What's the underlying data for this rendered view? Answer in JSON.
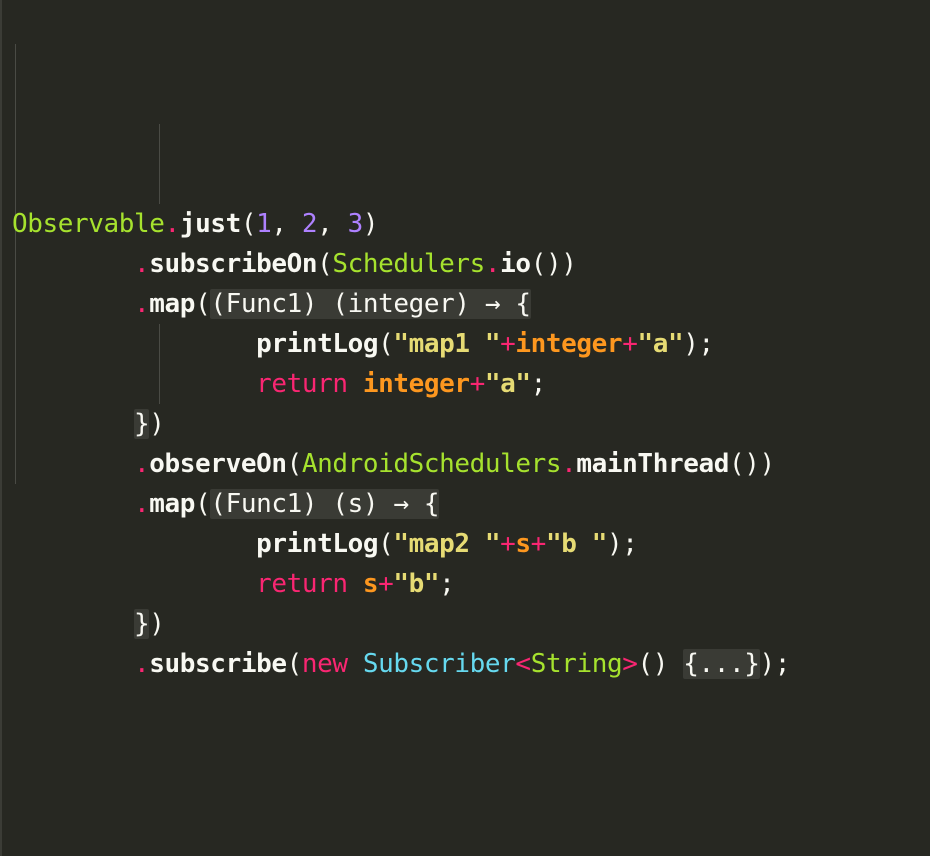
{
  "colors": {
    "background": "#272822",
    "default_text": "#f8f8f2",
    "class_green": "#a6e22e",
    "method_white": "#f8f8f2",
    "number_purple": "#ae81ff",
    "keyword_pink": "#f92672",
    "string_yellow": "#e6db74",
    "variable_orange": "#fd971f",
    "type_cyan": "#66d9ef",
    "fold_highlight": "#3a3b35"
  },
  "lines": [
    {
      "tokens": [
        {
          "text": "Observable",
          "color": "#a6e22e",
          "bold": false,
          "fold": false
        },
        {
          "text": ".",
          "color": "#f92672",
          "bold": false,
          "fold": false
        },
        {
          "text": "just",
          "color": "#f8f8f2",
          "bold": true,
          "fold": false
        },
        {
          "text": "(",
          "color": "#f8f8f2",
          "bold": false,
          "fold": false
        },
        {
          "text": "1",
          "color": "#ae81ff",
          "bold": false,
          "fold": false
        },
        {
          "text": ", ",
          "color": "#f8f8f2",
          "bold": false,
          "fold": false
        },
        {
          "text": "2",
          "color": "#ae81ff",
          "bold": false,
          "fold": false
        },
        {
          "text": ", ",
          "color": "#f8f8f2",
          "bold": false,
          "fold": false
        },
        {
          "text": "3",
          "color": "#ae81ff",
          "bold": false,
          "fold": false
        },
        {
          "text": ")",
          "color": "#f8f8f2",
          "bold": false,
          "fold": false
        }
      ]
    },
    {
      "tokens": [
        {
          "text": "        ",
          "color": "#f8f8f2",
          "bold": false,
          "fold": false
        },
        {
          "text": ".",
          "color": "#f92672",
          "bold": false,
          "fold": false
        },
        {
          "text": "subscribeOn",
          "color": "#f8f8f2",
          "bold": true,
          "fold": false
        },
        {
          "text": "(",
          "color": "#f8f8f2",
          "bold": false,
          "fold": false
        },
        {
          "text": "Schedulers",
          "color": "#a6e22e",
          "bold": false,
          "fold": false
        },
        {
          "text": ".",
          "color": "#f92672",
          "bold": false,
          "fold": false
        },
        {
          "text": "io",
          "color": "#f8f8f2",
          "bold": true,
          "fold": false
        },
        {
          "text": "())",
          "color": "#f8f8f2",
          "bold": false,
          "fold": false
        }
      ]
    },
    {
      "tokens": [
        {
          "text": "        ",
          "color": "#f8f8f2",
          "bold": false,
          "fold": false
        },
        {
          "text": ".",
          "color": "#f92672",
          "bold": false,
          "fold": false
        },
        {
          "text": "map",
          "color": "#f8f8f2",
          "bold": true,
          "fold": false
        },
        {
          "text": "(",
          "color": "#f8f8f2",
          "bold": false,
          "fold": false
        },
        {
          "text": "(Func1) (integer) → {",
          "color": "#f8f8f2",
          "bold": false,
          "fold": true
        }
      ]
    },
    {
      "tokens": [
        {
          "text": "                ",
          "color": "#f8f8f2",
          "bold": false,
          "fold": false
        },
        {
          "text": "printLog",
          "color": "#f8f8f2",
          "bold": true,
          "fold": false
        },
        {
          "text": "(",
          "color": "#f8f8f2",
          "bold": false,
          "fold": false
        },
        {
          "text": "\"map1 \"",
          "color": "#e6db74",
          "bold": true,
          "fold": false
        },
        {
          "text": "+",
          "color": "#f92672",
          "bold": false,
          "fold": false
        },
        {
          "text": "integer",
          "color": "#fd971f",
          "bold": true,
          "fold": false
        },
        {
          "text": "+",
          "color": "#f92672",
          "bold": false,
          "fold": false
        },
        {
          "text": "\"a\"",
          "color": "#e6db74",
          "bold": true,
          "fold": false
        },
        {
          "text": ");",
          "color": "#f8f8f2",
          "bold": false,
          "fold": false
        }
      ]
    },
    {
      "tokens": [
        {
          "text": "                ",
          "color": "#f8f8f2",
          "bold": false,
          "fold": false
        },
        {
          "text": "return",
          "color": "#f92672",
          "bold": false,
          "fold": false
        },
        {
          "text": " ",
          "color": "#f8f8f2",
          "bold": false,
          "fold": false
        },
        {
          "text": "integer",
          "color": "#fd971f",
          "bold": true,
          "fold": false
        },
        {
          "text": "+",
          "color": "#f92672",
          "bold": false,
          "fold": false
        },
        {
          "text": "\"a\"",
          "color": "#e6db74",
          "bold": true,
          "fold": false
        },
        {
          "text": ";",
          "color": "#f8f8f2",
          "bold": false,
          "fold": false
        }
      ]
    },
    {
      "tokens": [
        {
          "text": "        ",
          "color": "#f8f8f2",
          "bold": false,
          "fold": false
        },
        {
          "text": "}",
          "color": "#f8f8f2",
          "bold": false,
          "fold": true
        },
        {
          "text": ")",
          "color": "#f8f8f2",
          "bold": false,
          "fold": false
        }
      ]
    },
    {
      "tokens": [
        {
          "text": "        ",
          "color": "#f8f8f2",
          "bold": false,
          "fold": false
        },
        {
          "text": ".",
          "color": "#f92672",
          "bold": false,
          "fold": false
        },
        {
          "text": "observeOn",
          "color": "#f8f8f2",
          "bold": true,
          "fold": false
        },
        {
          "text": "(",
          "color": "#f8f8f2",
          "bold": false,
          "fold": false
        },
        {
          "text": "AndroidSchedulers",
          "color": "#a6e22e",
          "bold": false,
          "fold": false
        },
        {
          "text": ".",
          "color": "#f92672",
          "bold": false,
          "fold": false
        },
        {
          "text": "mainThread",
          "color": "#f8f8f2",
          "bold": true,
          "fold": false
        },
        {
          "text": "())",
          "color": "#f8f8f2",
          "bold": false,
          "fold": false
        }
      ]
    },
    {
      "tokens": [
        {
          "text": "        ",
          "color": "#f8f8f2",
          "bold": false,
          "fold": false
        },
        {
          "text": ".",
          "color": "#f92672",
          "bold": false,
          "fold": false
        },
        {
          "text": "map",
          "color": "#f8f8f2",
          "bold": true,
          "fold": false
        },
        {
          "text": "(",
          "color": "#f8f8f2",
          "bold": false,
          "fold": false
        },
        {
          "text": "(Func1) (s) → {",
          "color": "#f8f8f2",
          "bold": false,
          "fold": true
        }
      ]
    },
    {
      "tokens": [
        {
          "text": "                ",
          "color": "#f8f8f2",
          "bold": false,
          "fold": false
        },
        {
          "text": "printLog",
          "color": "#f8f8f2",
          "bold": true,
          "fold": false
        },
        {
          "text": "(",
          "color": "#f8f8f2",
          "bold": false,
          "fold": false
        },
        {
          "text": "\"map2 \"",
          "color": "#e6db74",
          "bold": true,
          "fold": false
        },
        {
          "text": "+",
          "color": "#f92672",
          "bold": false,
          "fold": false
        },
        {
          "text": "s",
          "color": "#fd971f",
          "bold": true,
          "fold": false
        },
        {
          "text": "+",
          "color": "#f92672",
          "bold": false,
          "fold": false
        },
        {
          "text": "\"b \"",
          "color": "#e6db74",
          "bold": true,
          "fold": false
        },
        {
          "text": ");",
          "color": "#f8f8f2",
          "bold": false,
          "fold": false
        }
      ]
    },
    {
      "tokens": [
        {
          "text": "                ",
          "color": "#f8f8f2",
          "bold": false,
          "fold": false
        },
        {
          "text": "return",
          "color": "#f92672",
          "bold": false,
          "fold": false
        },
        {
          "text": " ",
          "color": "#f8f8f2",
          "bold": false,
          "fold": false
        },
        {
          "text": "s",
          "color": "#fd971f",
          "bold": true,
          "fold": false
        },
        {
          "text": "+",
          "color": "#f92672",
          "bold": false,
          "fold": false
        },
        {
          "text": "\"b\"",
          "color": "#e6db74",
          "bold": true,
          "fold": false
        },
        {
          "text": ";",
          "color": "#f8f8f2",
          "bold": false,
          "fold": false
        }
      ]
    },
    {
      "tokens": [
        {
          "text": "        ",
          "color": "#f8f8f2",
          "bold": false,
          "fold": false
        },
        {
          "text": "}",
          "color": "#f8f8f2",
          "bold": false,
          "fold": true
        },
        {
          "text": ")",
          "color": "#f8f8f2",
          "bold": false,
          "fold": false
        }
      ]
    },
    {
      "tokens": [
        {
          "text": "        ",
          "color": "#f8f8f2",
          "bold": false,
          "fold": false
        },
        {
          "text": ".",
          "color": "#f92672",
          "bold": false,
          "fold": false
        },
        {
          "text": "subscribe",
          "color": "#f8f8f2",
          "bold": true,
          "fold": false
        },
        {
          "text": "(",
          "color": "#f8f8f2",
          "bold": false,
          "fold": false
        },
        {
          "text": "new",
          "color": "#f92672",
          "bold": false,
          "fold": false
        },
        {
          "text": " ",
          "color": "#f8f8f2",
          "bold": false,
          "fold": false
        },
        {
          "text": "Subscriber",
          "color": "#66d9ef",
          "bold": false,
          "fold": false
        },
        {
          "text": "<",
          "color": "#f92672",
          "bold": false,
          "fold": false
        },
        {
          "text": "String",
          "color": "#a6e22e",
          "bold": false,
          "fold": false
        },
        {
          "text": ">",
          "color": "#f92672",
          "bold": false,
          "fold": false
        },
        {
          "text": "() ",
          "color": "#f8f8f2",
          "bold": false,
          "fold": false
        },
        {
          "text": "{...}",
          "color": "#f8f8f2",
          "bold": false,
          "fold": true
        },
        {
          "text": ");",
          "color": "#f8f8f2",
          "bold": false,
          "fold": false
        }
      ]
    }
  ]
}
